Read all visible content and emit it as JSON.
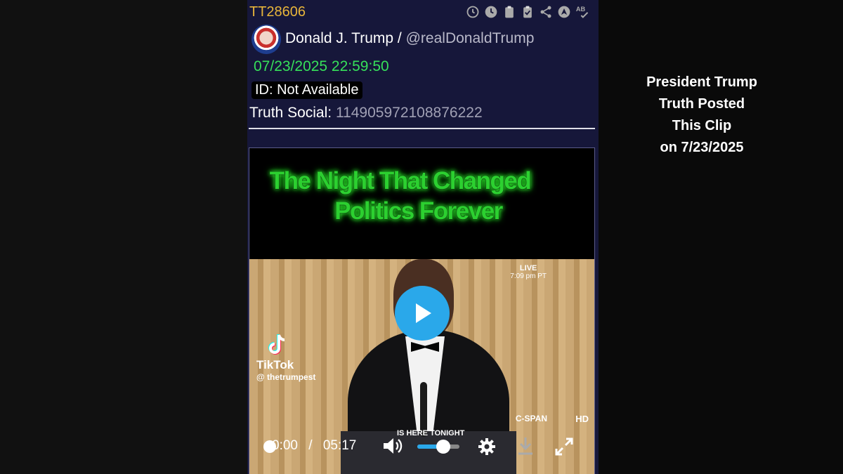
{
  "post": {
    "id": "TT28606",
    "author_name": "Donald J. Trump",
    "author_separator": "/",
    "author_handle": "@realDonaldTrump",
    "timestamp": "07/23/2025 22:59:50",
    "id_line": "ID: Not Available",
    "source_label": "Truth Social:",
    "source_id": "114905972108876222"
  },
  "toolbar_icons": [
    "clock-outline-icon",
    "clock-filled-icon",
    "clipboard-icon",
    "clipboard-check-icon",
    "share-icon",
    "navigate-up-icon",
    "spellcheck-icon"
  ],
  "video": {
    "title_line1": "The Night That Changed",
    "title_line2": "Politics Forever",
    "live_label": "LIVE",
    "live_time": "7:09 pm PT",
    "network": "C-SPAN",
    "hd_label": "HD",
    "lower_caption": "IS HERE TONIGHT",
    "watermark_name": "TikTok",
    "watermark_handle": "@ thetrumpest",
    "current_time": "0:00",
    "time_separator": "/",
    "duration": "05:17",
    "volume_level": 0.62,
    "progress": 0.0
  },
  "side_caption": {
    "line1": "President Trump",
    "line2": "Truth Posted",
    "line3": "This Clip",
    "line4": "on 7/23/2025"
  },
  "colors": {
    "post_id": "#e8b53a",
    "timestamp": "#36e05a",
    "panel_bg": "#16173a",
    "title_glow": "#2cd030",
    "play_button": "#2aa8ea"
  }
}
